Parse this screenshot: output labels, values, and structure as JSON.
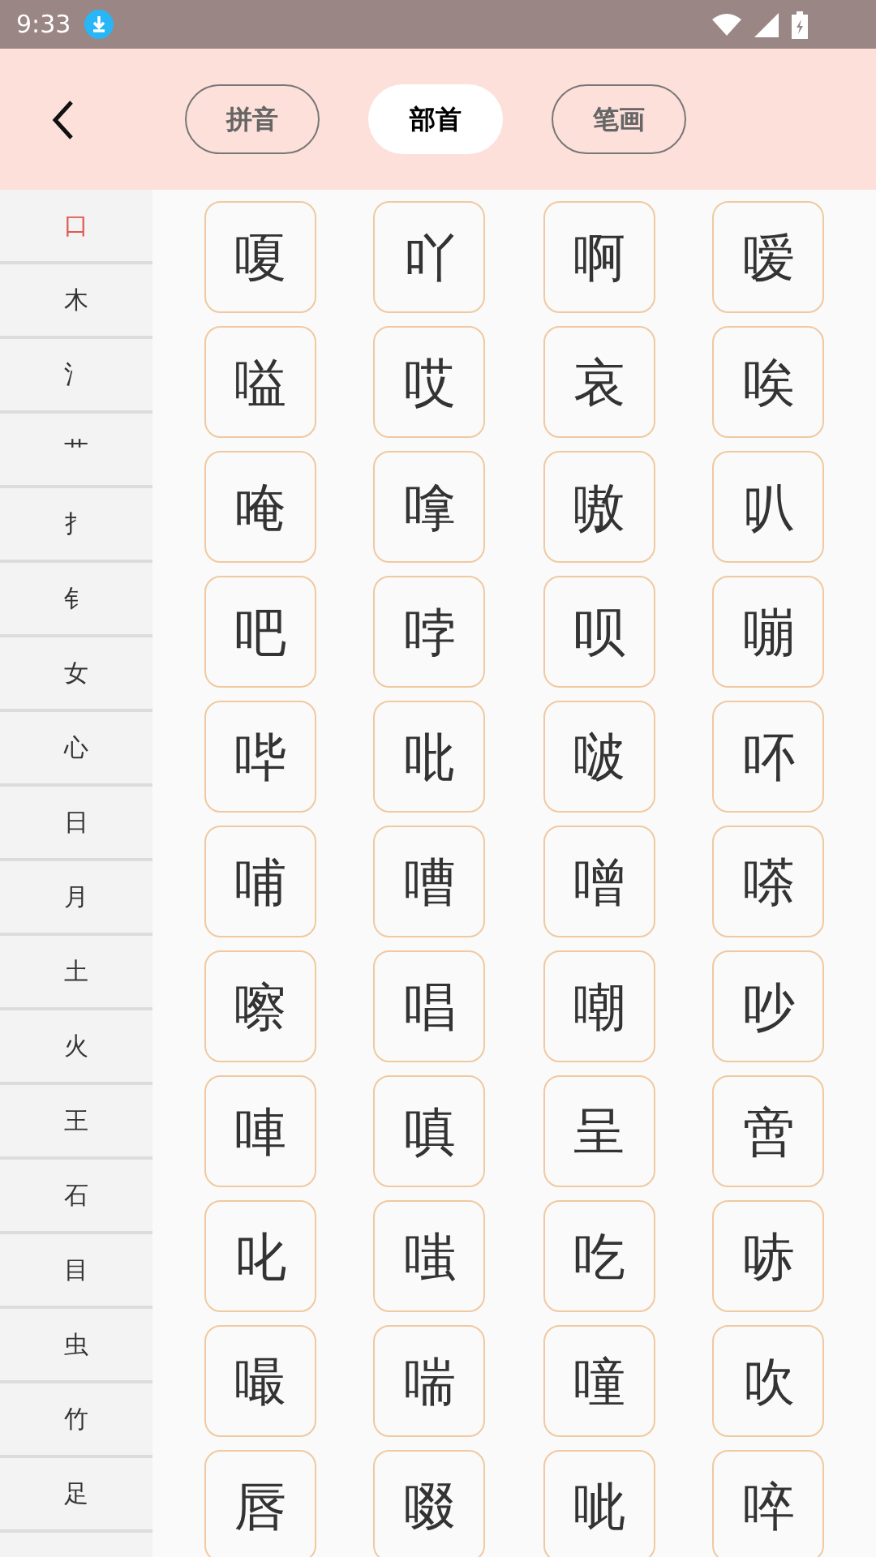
{
  "status_bar": {
    "time": "9:33"
  },
  "tabs": [
    {
      "label": "拼音",
      "selected": false
    },
    {
      "label": "部首",
      "selected": true
    },
    {
      "label": "笔画",
      "selected": false
    }
  ],
  "radicals": [
    {
      "label": "口",
      "selected": true
    },
    {
      "label": "木",
      "selected": false
    },
    {
      "label": "氵",
      "selected": false
    },
    {
      "label": "艹",
      "selected": false
    },
    {
      "label": "扌",
      "selected": false
    },
    {
      "label": "钅",
      "selected": false
    },
    {
      "label": "女",
      "selected": false
    },
    {
      "label": "心",
      "selected": false
    },
    {
      "label": "日",
      "selected": false
    },
    {
      "label": "月",
      "selected": false
    },
    {
      "label": "土",
      "selected": false
    },
    {
      "label": "火",
      "selected": false
    },
    {
      "label": "王",
      "selected": false
    },
    {
      "label": "石",
      "selected": false
    },
    {
      "label": "目",
      "selected": false
    },
    {
      "label": "虫",
      "selected": false
    },
    {
      "label": "竹",
      "selected": false
    },
    {
      "label": "足",
      "selected": false
    }
  ],
  "characters": [
    "嗄",
    "吖",
    "啊",
    "嗳",
    "嗌",
    "哎",
    "哀",
    "唉",
    "唵",
    "嗱",
    "嗷",
    "叭",
    "吧",
    "哱",
    "呗",
    "嘣",
    "哔",
    "吡",
    "啵",
    "吥",
    "哺",
    "嘈",
    "噌",
    "嗏",
    "嚓",
    "唱",
    "嘲",
    "吵",
    "唓",
    "嗔",
    "呈",
    "啻",
    "叱",
    "嗤",
    "吃",
    "哧",
    "嘬",
    "喘",
    "噇",
    "吹",
    "唇",
    "啜",
    "呲",
    "啐"
  ]
}
